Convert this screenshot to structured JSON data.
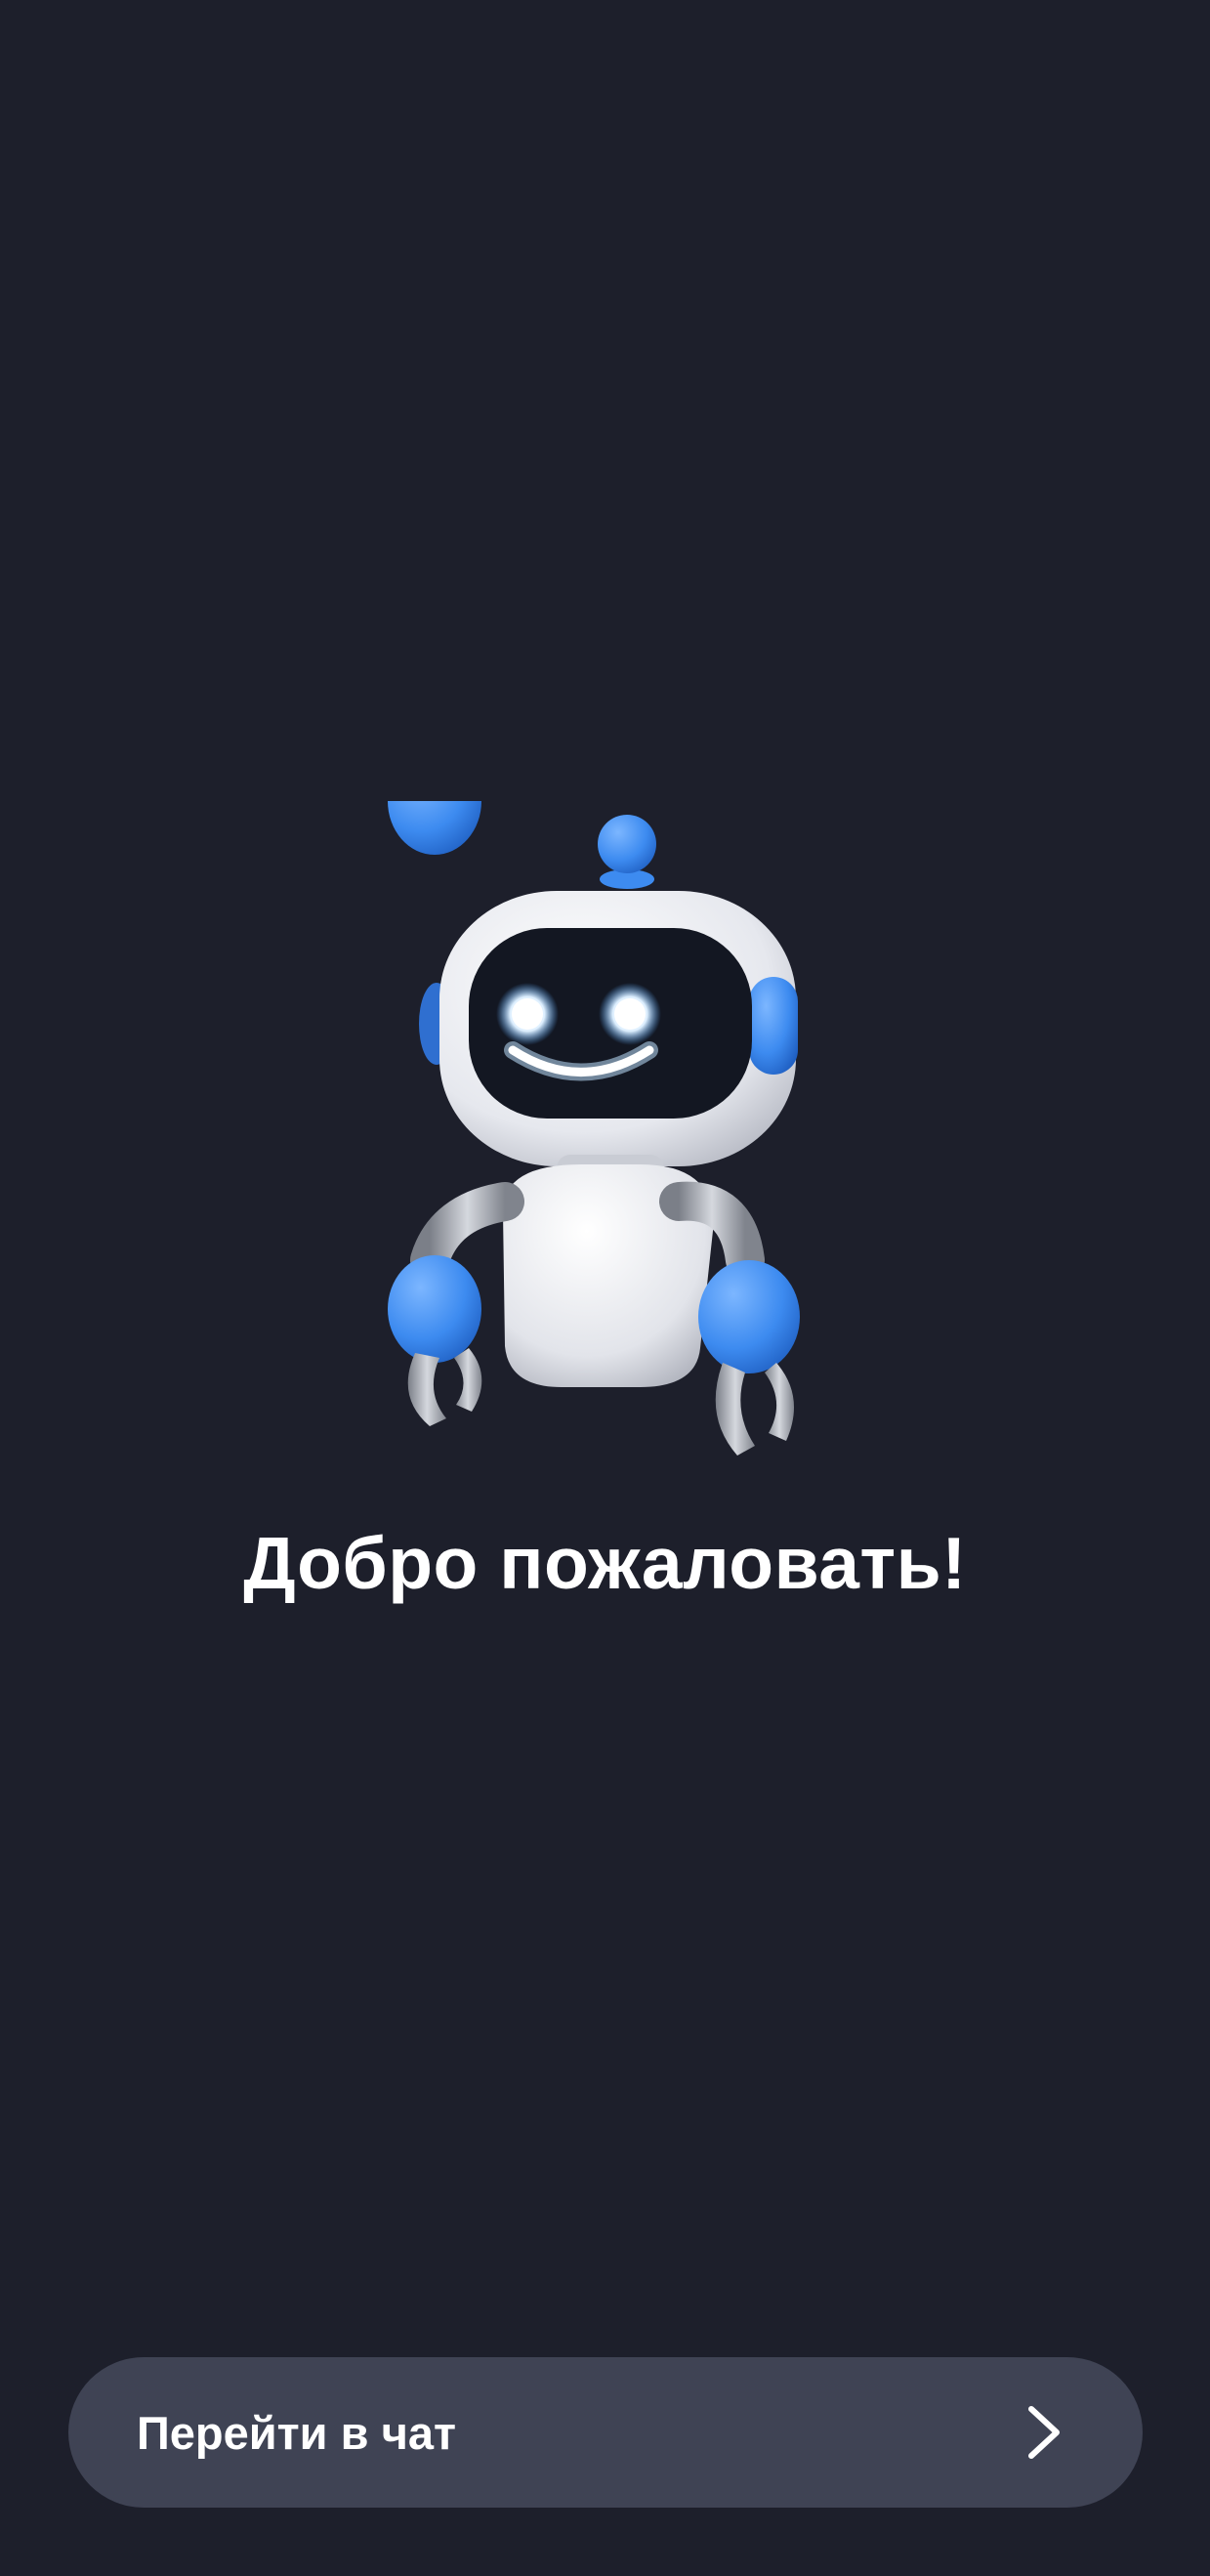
{
  "welcome": {
    "title": "Добро пожаловать!"
  },
  "cta": {
    "label": "Перейти в чат",
    "icon": "chevron-right-icon"
  },
  "mascot": {
    "icon": "robot-mascot"
  },
  "colors": {
    "background": "#1d1f2b",
    "button_bg": "#3f4354",
    "accent_blue": "#3d8bf0",
    "robot_white": "#eef0f4",
    "face_dark": "#131722",
    "eye_glow": "#e9f4ff"
  }
}
